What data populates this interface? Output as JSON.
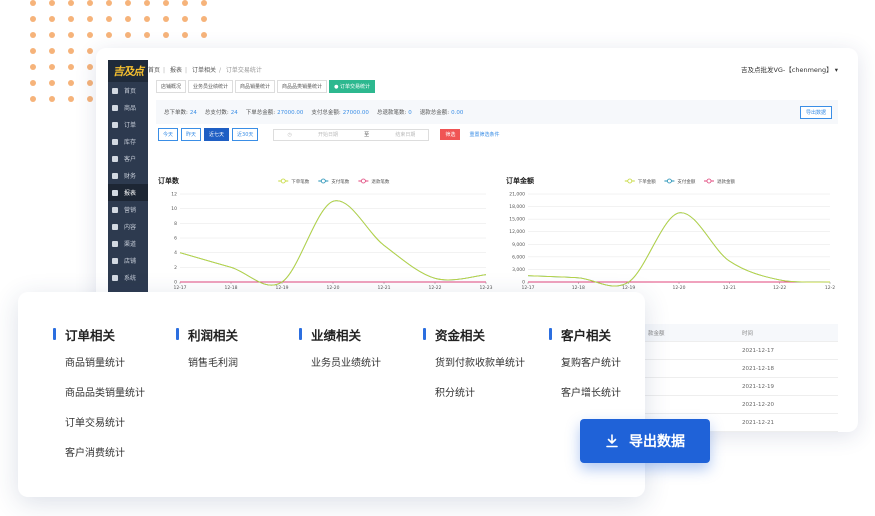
{
  "app": {
    "logo_text": "吉及点",
    "breadcrumb": [
      "首页",
      "报表",
      "订单相关",
      "订单交易统计"
    ],
    "user": "吉及点批发VG-【chenmeng】 ▾"
  },
  "sidebar": {
    "items": [
      {
        "label": "首页",
        "icon": "home-icon"
      },
      {
        "label": "商品",
        "icon": "cart-icon"
      },
      {
        "label": "订单",
        "icon": "order-icon"
      },
      {
        "label": "库存",
        "icon": "grid-icon"
      },
      {
        "label": "客户",
        "icon": "users-icon"
      },
      {
        "label": "财务",
        "icon": "wallet-icon"
      },
      {
        "label": "报表",
        "icon": "report-icon"
      },
      {
        "label": "营销",
        "icon": "marketing-icon"
      },
      {
        "label": "内容",
        "icon": "content-icon"
      },
      {
        "label": "渠道",
        "icon": "chart-icon"
      },
      {
        "label": "店铺",
        "icon": "shop-icon"
      },
      {
        "label": "系统",
        "icon": "system-icon"
      }
    ],
    "active_index": 6
  },
  "tabs": [
    {
      "label": "店铺概况",
      "active": false
    },
    {
      "label": "业务员业绩统计",
      "active": false
    },
    {
      "label": "商品销量统计",
      "active": false
    },
    {
      "label": "商品品类销量统计",
      "active": false
    },
    {
      "label": "● 订单交易统计",
      "active": true
    }
  ],
  "summary": {
    "items": [
      {
        "label": "总下单数:",
        "value": "24"
      },
      {
        "label": "总支付数:",
        "value": "24"
      },
      {
        "label": "下单总金额:",
        "value": "27000.00"
      },
      {
        "label": "支付总金额:",
        "value": "27000.00"
      },
      {
        "label": "总退款笔数:",
        "value": "0"
      },
      {
        "label": "退款总金额:",
        "value": "0.00"
      }
    ],
    "export_label": "导出数据"
  },
  "filters": {
    "buttons": [
      {
        "label": "今天",
        "active": false
      },
      {
        "label": "昨天",
        "active": false
      },
      {
        "label": "近七天",
        "active": true
      },
      {
        "label": "近30天",
        "active": false
      }
    ],
    "start_placeholder": "开始日期",
    "range_sep": "至",
    "end_placeholder": "结束日期",
    "filter_label": "筛选",
    "reset_label": "重置筛选条件"
  },
  "chart_data": [
    {
      "type": "line",
      "title": "订单数",
      "categories": [
        "12-17",
        "12-18",
        "12-19",
        "12-20",
        "12-21",
        "12-22",
        "12-23"
      ],
      "yticks": [
        0,
        2,
        4,
        6,
        8,
        10,
        12
      ],
      "ylim": [
        0,
        12
      ],
      "series": [
        {
          "name": "下单笔数",
          "color": "#c5d93a",
          "values": [
            4,
            2,
            0,
            11,
            5,
            0.5,
            1
          ]
        },
        {
          "name": "支付笔数",
          "color": "#1f8fb5",
          "values": [
            4,
            2,
            0,
            11,
            5,
            0.5,
            1
          ]
        },
        {
          "name": "退款笔数",
          "color": "#e0457b",
          "values": [
            0,
            0,
            0,
            0,
            0,
            0,
            0
          ]
        }
      ]
    },
    {
      "type": "line",
      "title": "订单金额",
      "categories": [
        "12-17",
        "12-18",
        "12-19",
        "12-20",
        "12-21",
        "12-22",
        "12-2"
      ],
      "yticks": [
        "0",
        "3,000",
        "6,000",
        "9,000",
        "12,000",
        "15,000",
        "18,000",
        "21,000"
      ],
      "ylim": [
        0,
        21000
      ],
      "series": [
        {
          "name": "下单金额",
          "color": "#c5d93a",
          "values": [
            1500,
            1000,
            0,
            16500,
            5000,
            500,
            0
          ]
        },
        {
          "name": "支付金额",
          "color": "#1f8fb5",
          "values": [
            1500,
            1000,
            0,
            16500,
            5000,
            500,
            0
          ]
        },
        {
          "name": "退款金额",
          "color": "#e0457b",
          "values": [
            0,
            0,
            0,
            0,
            0,
            0,
            0
          ]
        }
      ]
    }
  ],
  "table": {
    "col1": "款金额",
    "col2": "时间",
    "rows": [
      "2021-12-17",
      "2021-12-18",
      "2021-12-19",
      "2021-12-20",
      "2021-12-21"
    ]
  },
  "menu": {
    "columns": [
      {
        "title": "订单相关",
        "items": [
          "商品销量统计",
          "商品品类销量统计",
          "订单交易统计",
          "客户消费统计"
        ]
      },
      {
        "title": "利润相关",
        "items": [
          "销售毛利润"
        ]
      },
      {
        "title": "业绩相关",
        "items": [
          "业务员业绩统计"
        ]
      },
      {
        "title": "资金相关",
        "items": [
          "货到付款收款单统计",
          "积分统计"
        ]
      },
      {
        "title": "客户相关",
        "items": [
          "复购客户统计",
          "客户增长统计"
        ]
      }
    ]
  },
  "export_button": {
    "label": "导出数据",
    "icon": "download-icon"
  }
}
